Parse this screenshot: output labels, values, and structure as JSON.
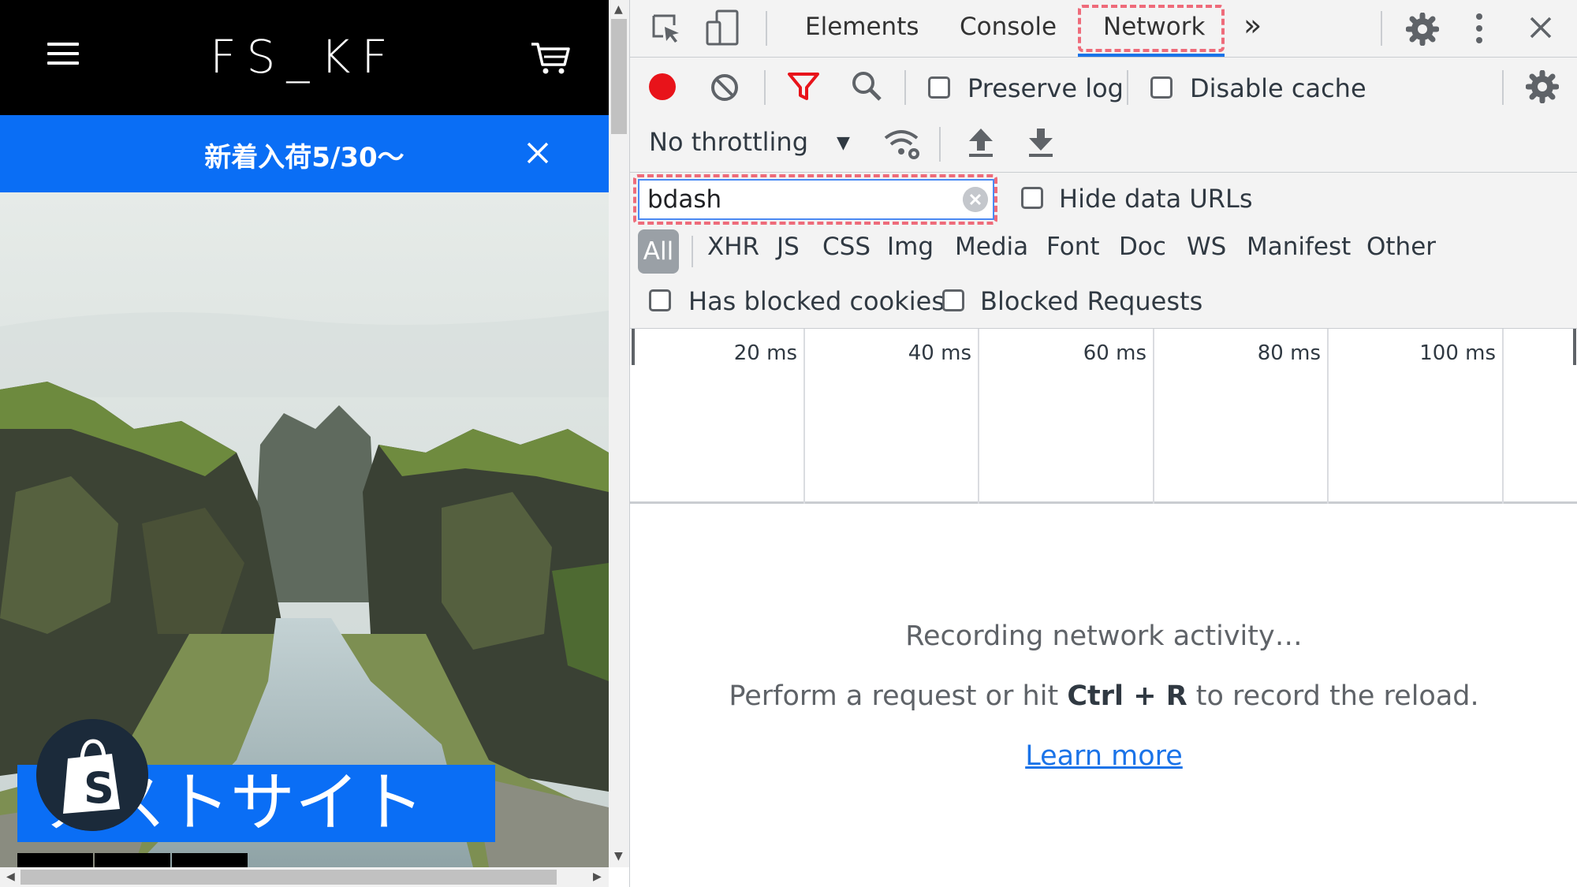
{
  "site": {
    "logo": "FS_KF",
    "announcement": "新着入荷5/30〜",
    "hero_caption": "テストサイト"
  },
  "devtools": {
    "tabs": [
      "Elements",
      "Console",
      "Network"
    ],
    "active_tab": "Network",
    "more_tabs_glyph": "»",
    "toolbar": {
      "preserve_log": "Preserve log",
      "disable_cache": "Disable cache",
      "throttling": "No throttling"
    },
    "filter": {
      "value": "bdash",
      "hide_data_urls": "Hide data URLs",
      "types": [
        "All",
        "XHR",
        "JS",
        "CSS",
        "Img",
        "Media",
        "Font",
        "Doc",
        "WS",
        "Manifest",
        "Other"
      ],
      "active_type": "All",
      "has_blocked_cookies": "Has blocked cookies",
      "blocked_requests": "Blocked Requests"
    },
    "timeline_ticks": [
      "20 ms",
      "40 ms",
      "60 ms",
      "80 ms",
      "100 ms"
    ],
    "empty_state": {
      "title": "Recording network activity…",
      "hint_prefix": "Perform a request or hit ",
      "hint_keys": "Ctrl + R",
      "hint_suffix": " to record the reload.",
      "link": "Learn more"
    },
    "colors": {
      "record": "#e8131a",
      "filter_icon": "#e8131a",
      "highlight": "#ee6b7a",
      "link": "#1a73e8",
      "banner": "#0a6ef5"
    }
  }
}
